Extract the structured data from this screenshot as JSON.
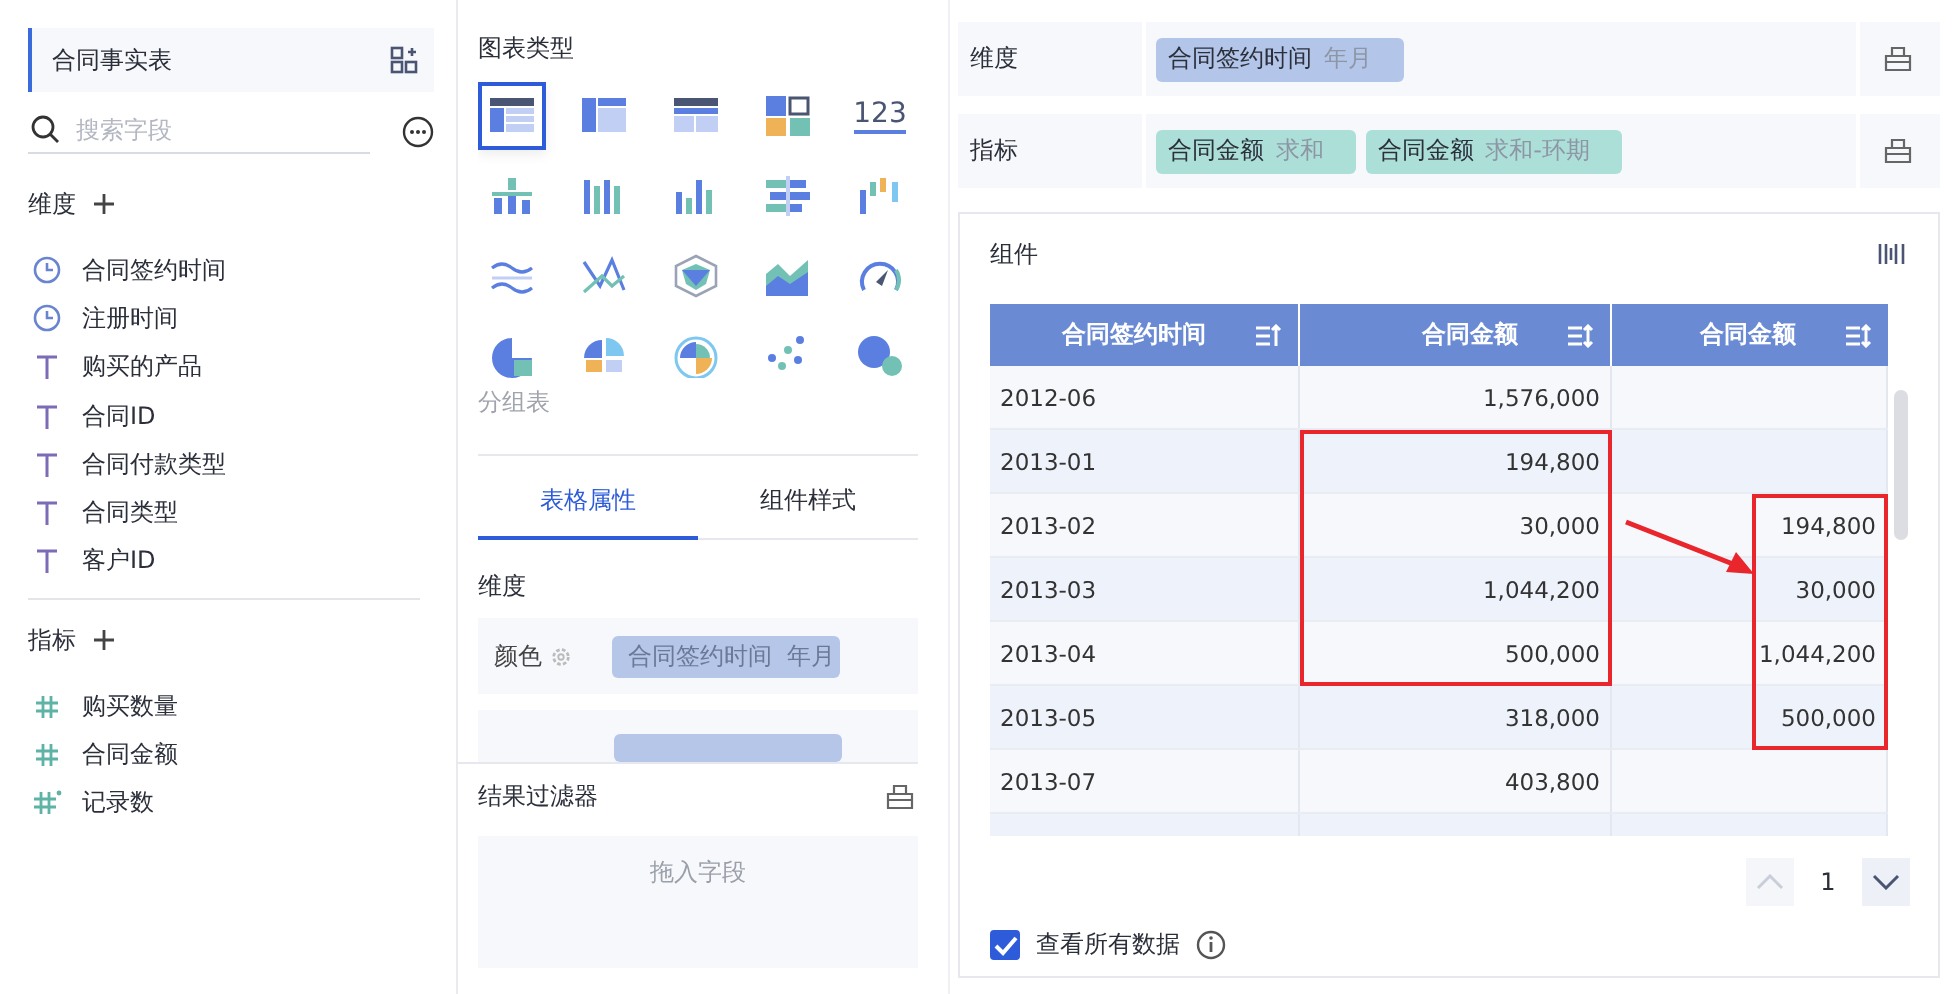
{
  "dataset": {
    "title": "合同事实表"
  },
  "search": {
    "placeholder": "搜索字段"
  },
  "dimensions": {
    "title": "维度",
    "fields": [
      {
        "kind": "date",
        "label": "合同签约时间"
      },
      {
        "kind": "date",
        "label": "注册时间"
      },
      {
        "kind": "text",
        "label": "购买的产品"
      },
      {
        "kind": "text",
        "label": "合同ID"
      },
      {
        "kind": "text",
        "label": "合同付款类型"
      },
      {
        "kind": "text",
        "label": "合同类型"
      },
      {
        "kind": "text",
        "label": "客户ID"
      }
    ]
  },
  "measures": {
    "title": "指标",
    "fields": [
      {
        "kind": "number",
        "label": "购买数量"
      },
      {
        "kind": "number",
        "label": "合同金额"
      },
      {
        "kind": "count",
        "label": "记录数"
      }
    ]
  },
  "chart_types": {
    "title": "图表类型",
    "hint": "分组表",
    "items": [
      {
        "selected": true
      },
      {
        "selected": false
      },
      {
        "selected": false
      },
      {
        "selected": false
      },
      {
        "selected": false,
        "label": "123"
      },
      {
        "selected": false
      },
      {
        "selected": false
      },
      {
        "selected": false
      },
      {
        "selected": false
      },
      {
        "selected": false
      },
      {
        "selected": false
      },
      {
        "selected": false
      },
      {
        "selected": false
      },
      {
        "selected": false
      },
      {
        "selected": false
      },
      {
        "selected": false
      },
      {
        "selected": false
      },
      {
        "selected": false
      },
      {
        "selected": false
      },
      {
        "selected": false
      }
    ]
  },
  "property_tabs": [
    {
      "label": "表格属性",
      "selected": true
    },
    {
      "label": "组件样式",
      "selected": false
    }
  ],
  "properties": {
    "title": "维度",
    "rows": [
      {
        "label": "颜色",
        "tag": {
          "field": "合同签约时间",
          "aggregation": "年月"
        }
      }
    ]
  },
  "result_filter": {
    "title": "结果过滤器",
    "placeholder": "拖入字段"
  },
  "shelves": [
    {
      "label": "维度",
      "tags": [
        {
          "kind": "dimension",
          "field": "合同签约时间",
          "aggregation": "年月"
        }
      ]
    },
    {
      "label": "指标",
      "tags": [
        {
          "kind": "measure",
          "field": "合同金额",
          "aggregation": "求和"
        },
        {
          "kind": "measure",
          "field": "合同金额",
          "aggregation": "求和-环期"
        }
      ]
    }
  ],
  "component": {
    "title": "组件",
    "table": {
      "columns": [
        {
          "label": "合同签约时间",
          "sorted": true
        },
        {
          "label": "合同金额",
          "sorted": false
        },
        {
          "label": "合同金额",
          "sorted": false
        }
      ],
      "rows": [
        {
          "cells": [
            "2012-06",
            "1,576,000"
          ],
          "in_left_box": false,
          "in_right_box": false
        },
        {
          "cells": [
            "2013-01",
            "194,800"
          ],
          "in_left_box": true,
          "in_right_box": false
        },
        {
          "cells": [
            "2013-02",
            "30,000",
            "194,800"
          ],
          "in_left_box": true,
          "in_right_box": true
        },
        {
          "cells": [
            "2013-03",
            "1,044,200",
            "30,000"
          ],
          "in_left_box": true,
          "in_right_box": true
        },
        {
          "cells": [
            "2013-04",
            "500,000",
            "1,044,200"
          ],
          "in_left_box": true,
          "in_right_box": true
        },
        {
          "cells": [
            "2013-05",
            "318,000",
            "500,000"
          ],
          "in_left_box": false,
          "in_right_box": true
        },
        {
          "cells": [
            "2013-07",
            "403,800"
          ],
          "in_left_box": false,
          "in_right_box": false
        }
      ],
      "arrow": true
    },
    "pagination": {
      "page": "1",
      "prev_disabled": true
    },
    "view_all": {
      "label": "查看所有数据",
      "checked": true
    }
  }
}
